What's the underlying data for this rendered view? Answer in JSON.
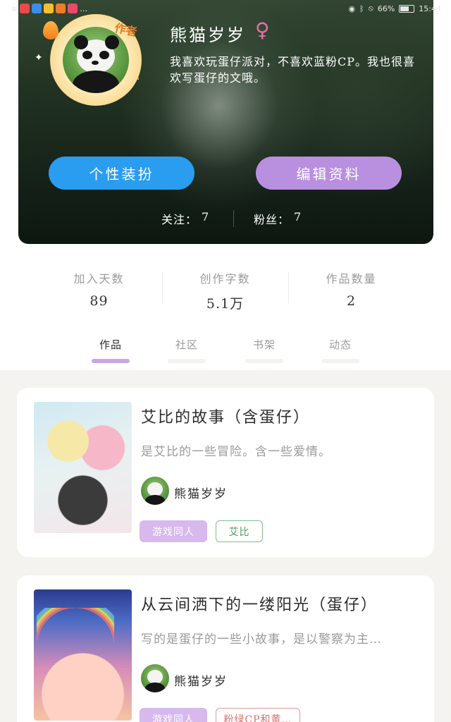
{
  "status_bar": {
    "battery": "66%",
    "time": "15:44"
  },
  "profile": {
    "author_badge": "作者",
    "username": "熊猫岁岁",
    "gender_symbol": "♀",
    "bio": "我喜欢玩蛋仔派对，不喜欢蓝粉CP。我也很喜欢写蛋仔的文哦。",
    "dress_button": "个性装扮",
    "edit_button": "编辑资料",
    "following_label": "关注：",
    "following_count": "7",
    "followers_label": "粉丝：",
    "followers_count": "7"
  },
  "stats": [
    {
      "label": "加入天数",
      "value": "89"
    },
    {
      "label": "创作字数",
      "value": "5.1万"
    },
    {
      "label": "作品数量",
      "value": "2"
    }
  ],
  "tabs": [
    {
      "label": "作品",
      "active": true
    },
    {
      "label": "社区",
      "active": false
    },
    {
      "label": "书架",
      "active": false
    },
    {
      "label": "动态",
      "active": false
    }
  ],
  "works": [
    {
      "title": "艾比的故事（含蛋仔）",
      "description": "是艾比的一些冒险。含一些爱情。",
      "author": "熊猫岁岁",
      "tags": [
        "游戏同人",
        "艾比"
      ]
    },
    {
      "title": "从云间洒下的一缕阳光（蛋仔）",
      "description": "写的是蛋仔的一些小故事，是以警察为主…",
      "author": "熊猫岁岁",
      "tags": [
        "游戏同人",
        "粉绿CP和黄…"
      ]
    }
  ],
  "colors": {
    "accent_blue": "#2a9df0",
    "accent_purple": "#b98fe0",
    "tab_indicator": "#c7a7e6"
  }
}
